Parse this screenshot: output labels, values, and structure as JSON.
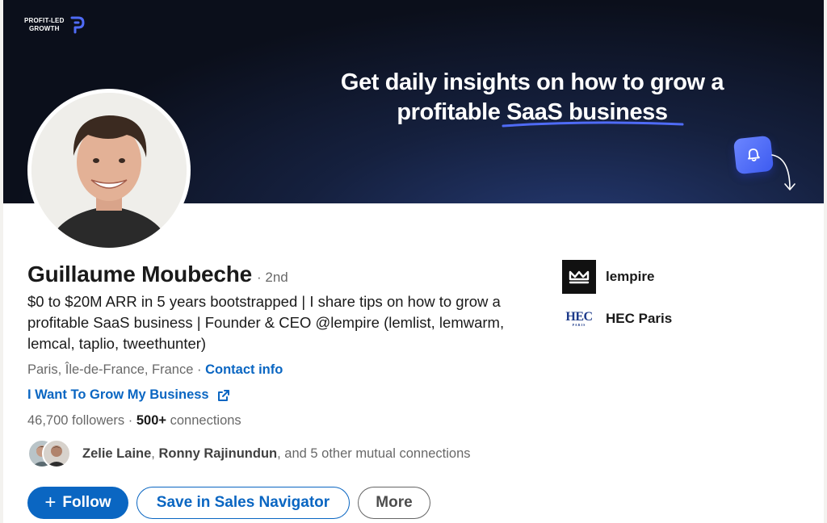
{
  "banner": {
    "brand_text_1": "PROFIT-LED",
    "brand_text_2": "GROWTH",
    "headline_line1": "Get daily insights on how to grow a",
    "headline_line2": "profitable SaaS business",
    "bell_icon": "bell-icon",
    "accent_color": "#4f6bf6"
  },
  "profile": {
    "name": "Guillaume Moubeche",
    "degree": "· 2nd",
    "headline": "$0 to $20M ARR in 5 years bootstrapped | I share tips on how to grow a profitable SaaS business | Founder & CEO @lempire (lemlist, lemwarm, lemcal, taplio, tweethunter)",
    "location": "Paris, Île-de-France, France ·",
    "contact_info": "Contact info",
    "website_label": "I Want To Grow My Business",
    "followers": "46,700 followers",
    "connections_count": "500+",
    "connections_label": "connections",
    "mutual": {
      "person1": "Zelie Laine",
      "separator": ",",
      "person2": "Ronny Rajinundun",
      "rest": ", and 5 other mutual connections"
    }
  },
  "actions": {
    "follow": "Follow",
    "follow_icon": "+",
    "save_sales_navigator": "Save in Sales Navigator",
    "more": "More"
  },
  "organizations": [
    {
      "name": "lempire",
      "icon": "lempire-crown-logo"
    },
    {
      "name": "HEC Paris",
      "logo_text": "HEC",
      "logo_sub": "PARIS"
    }
  ],
  "colors": {
    "primary_blue": "#0a66c2",
    "banner_dark": "#0b0f1b"
  }
}
